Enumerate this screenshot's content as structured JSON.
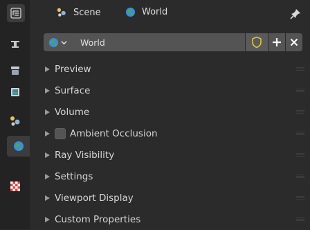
{
  "header": {
    "scene_label": "Scene",
    "world_label": "World"
  },
  "id_block": {
    "name": "World"
  },
  "panels": [
    {
      "label": "Preview",
      "checkbox": false
    },
    {
      "label": "Surface",
      "checkbox": false
    },
    {
      "label": "Volume",
      "checkbox": false
    },
    {
      "label": "Ambient Occlusion",
      "checkbox": true
    },
    {
      "label": "Ray Visibility",
      "checkbox": false
    },
    {
      "label": "Settings",
      "checkbox": false
    },
    {
      "label": "Viewport Display",
      "checkbox": false
    },
    {
      "label": "Custom Properties",
      "checkbox": false
    }
  ],
  "tabs": [
    {
      "icon": "tool-icon"
    },
    {
      "icon": "render-icon"
    },
    {
      "icon": "output-icon"
    },
    {
      "icon": "view-layer-icon"
    },
    {
      "icon": "scene-icon"
    },
    {
      "icon": "world-icon",
      "active": true
    },
    {
      "icon": "texture-icon"
    }
  ],
  "colors": {
    "background": "#2b2b2b",
    "tab_bar": "#232323",
    "field": "#545454",
    "world_blue": "#3a8fd6",
    "world_green": "#5aa646",
    "fake_user_yellow": "#d8c24a"
  }
}
